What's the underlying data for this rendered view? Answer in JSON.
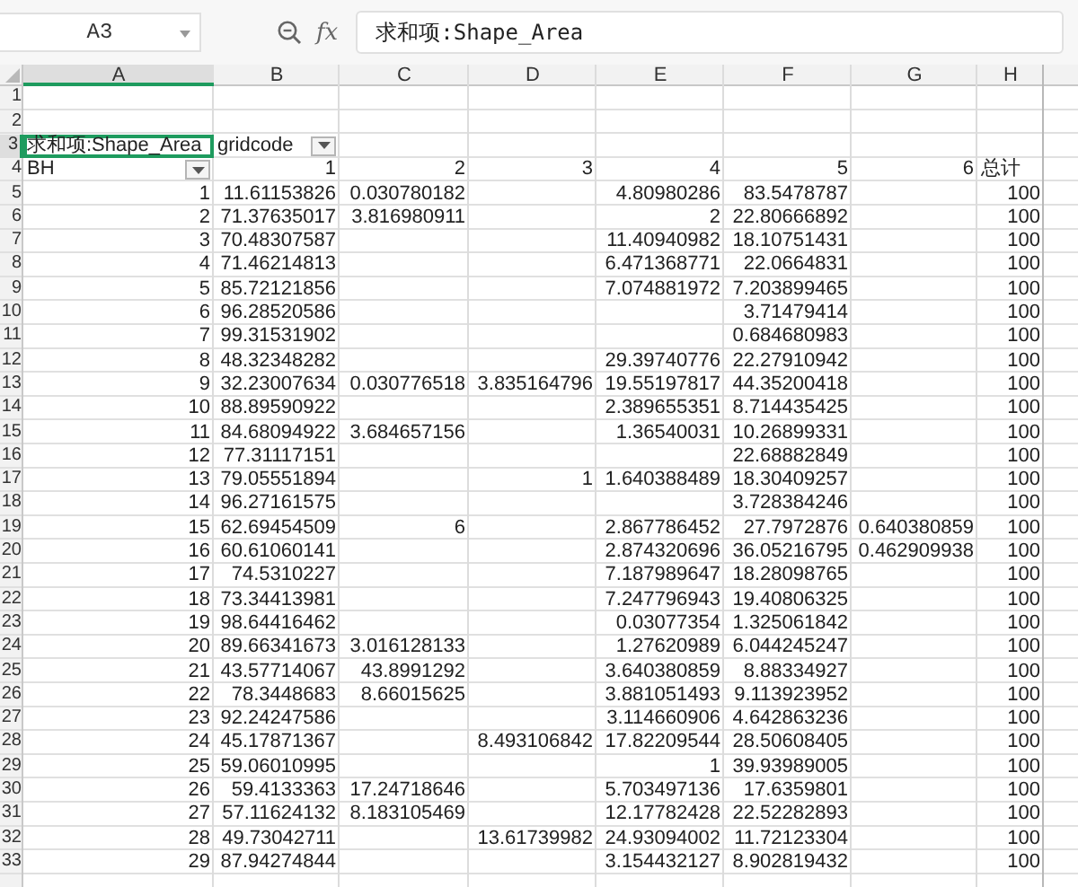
{
  "name_box": "A3",
  "fx_label": "fx",
  "formula": "求和项:Shape_Area",
  "columns": {
    "A": {
      "label": "A",
      "selected": true
    },
    "B": {
      "label": "B",
      "selected": false
    },
    "C": {
      "label": "C",
      "selected": false
    },
    "D": {
      "label": "D",
      "selected": false
    },
    "E": {
      "label": "E",
      "selected": false
    },
    "F": {
      "label": "F",
      "selected": false
    },
    "G": {
      "label": "G",
      "selected": false
    },
    "H": {
      "label": "H",
      "selected": false
    }
  },
  "rows": [
    {
      "row": "1",
      "selected": false
    },
    {
      "row": "2",
      "selected": false
    },
    {
      "row": "3",
      "selected": true,
      "cells": {
        "A": {
          "text": "求和项:Shape_Area",
          "kind": "label",
          "selected": true
        },
        "B": {
          "text": "gridcode",
          "kind": "label",
          "filter": true,
          "selected": false
        }
      }
    },
    {
      "row": "4",
      "selected": false,
      "cells": {
        "A": {
          "text": "BH",
          "kind": "label",
          "filter": true,
          "selected": false
        },
        "B": {
          "text": "1",
          "selected": false
        },
        "C": {
          "text": "2",
          "selected": false
        },
        "D": {
          "text": "3",
          "selected": false
        },
        "E": {
          "text": "4",
          "selected": false
        },
        "F": {
          "text": "5",
          "selected": false
        },
        "G": {
          "text": "6",
          "selected": false
        },
        "H": {
          "text": "总计",
          "kind": "label",
          "selected": false
        }
      }
    },
    {
      "row": "5",
      "selected": false,
      "cells": {
        "A": {
          "text": "1",
          "selected": false
        },
        "B": {
          "text": "11.61153826",
          "selected": false
        },
        "C": {
          "text": "0.030780182",
          "selected": false
        },
        "E": {
          "text": "4.80980286",
          "selected": false
        },
        "F": {
          "text": "83.5478787",
          "selected": false
        },
        "H": {
          "text": "100",
          "selected": false
        }
      }
    },
    {
      "row": "6",
      "selected": false,
      "cells": {
        "A": {
          "text": "2",
          "selected": false
        },
        "B": {
          "text": "71.37635017",
          "selected": false
        },
        "C": {
          "text": "3.816980911",
          "selected": false
        },
        "E": {
          "text": "2",
          "selected": false
        },
        "F": {
          "text": "22.80666892",
          "selected": false
        },
        "H": {
          "text": "100",
          "selected": false
        }
      }
    },
    {
      "row": "7",
      "selected": false,
      "cells": {
        "A": {
          "text": "3",
          "selected": false
        },
        "B": {
          "text": "70.48307587",
          "selected": false
        },
        "E": {
          "text": "11.40940982",
          "selected": false
        },
        "F": {
          "text": "18.10751431",
          "selected": false
        },
        "H": {
          "text": "100",
          "selected": false
        }
      }
    },
    {
      "row": "8",
      "selected": false,
      "cells": {
        "A": {
          "text": "4",
          "selected": false
        },
        "B": {
          "text": "71.46214813",
          "selected": false
        },
        "E": {
          "text": "6.471368771",
          "selected": false
        },
        "F": {
          "text": "22.0664831",
          "selected": false
        },
        "H": {
          "text": "100",
          "selected": false
        }
      }
    },
    {
      "row": "9",
      "selected": false,
      "cells": {
        "A": {
          "text": "5",
          "selected": false
        },
        "B": {
          "text": "85.72121856",
          "selected": false
        },
        "E": {
          "text": "7.074881972",
          "selected": false
        },
        "F": {
          "text": "7.203899465",
          "selected": false
        },
        "H": {
          "text": "100",
          "selected": false
        }
      }
    },
    {
      "row": "10",
      "selected": false,
      "cells": {
        "A": {
          "text": "6",
          "selected": false
        },
        "B": {
          "text": "96.28520586",
          "selected": false
        },
        "F": {
          "text": "3.71479414",
          "selected": false
        },
        "H": {
          "text": "100",
          "selected": false
        }
      }
    },
    {
      "row": "11",
      "selected": false,
      "cells": {
        "A": {
          "text": "7",
          "selected": false
        },
        "B": {
          "text": "99.31531902",
          "selected": false
        },
        "F": {
          "text": "0.684680983",
          "selected": false
        },
        "H": {
          "text": "100",
          "selected": false
        }
      }
    },
    {
      "row": "12",
      "selected": false,
      "cells": {
        "A": {
          "text": "8",
          "selected": false
        },
        "B": {
          "text": "48.32348282",
          "selected": false
        },
        "E": {
          "text": "29.39740776",
          "selected": false
        },
        "F": {
          "text": "22.27910942",
          "selected": false
        },
        "H": {
          "text": "100",
          "selected": false
        }
      }
    },
    {
      "row": "13",
      "selected": false,
      "cells": {
        "A": {
          "text": "9",
          "selected": false
        },
        "B": {
          "text": "32.23007634",
          "selected": false
        },
        "C": {
          "text": "0.030776518",
          "selected": false
        },
        "D": {
          "text": "3.835164796",
          "selected": false
        },
        "E": {
          "text": "19.55197817",
          "selected": false
        },
        "F": {
          "text": "44.35200418",
          "selected": false
        },
        "H": {
          "text": "100",
          "selected": false
        }
      }
    },
    {
      "row": "14",
      "selected": false,
      "cells": {
        "A": {
          "text": "10",
          "selected": false
        },
        "B": {
          "text": "88.89590922",
          "selected": false
        },
        "E": {
          "text": "2.389655351",
          "selected": false
        },
        "F": {
          "text": "8.714435425",
          "selected": false
        },
        "H": {
          "text": "100",
          "selected": false
        }
      }
    },
    {
      "row": "15",
      "selected": false,
      "cells": {
        "A": {
          "text": "11",
          "selected": false
        },
        "B": {
          "text": "84.68094922",
          "selected": false
        },
        "C": {
          "text": "3.684657156",
          "selected": false
        },
        "E": {
          "text": "1.36540031",
          "selected": false
        },
        "F": {
          "text": "10.26899331",
          "selected": false
        },
        "H": {
          "text": "100",
          "selected": false
        }
      }
    },
    {
      "row": "16",
      "selected": false,
      "cells": {
        "A": {
          "text": "12",
          "selected": false
        },
        "B": {
          "text": "77.31117151",
          "selected": false
        },
        "F": {
          "text": "22.68882849",
          "selected": false
        },
        "H": {
          "text": "100",
          "selected": false
        }
      }
    },
    {
      "row": "17",
      "selected": false,
      "cells": {
        "A": {
          "text": "13",
          "selected": false
        },
        "B": {
          "text": "79.05551894",
          "selected": false
        },
        "D": {
          "text": "1",
          "selected": false
        },
        "E": {
          "text": "1.640388489",
          "selected": false
        },
        "F": {
          "text": "18.30409257",
          "selected": false
        },
        "H": {
          "text": "100",
          "selected": false
        }
      }
    },
    {
      "row": "18",
      "selected": false,
      "cells": {
        "A": {
          "text": "14",
          "selected": false
        },
        "B": {
          "text": "96.27161575",
          "selected": false
        },
        "F": {
          "text": "3.728384246",
          "selected": false
        },
        "H": {
          "text": "100",
          "selected": false
        }
      }
    },
    {
      "row": "19",
      "selected": false,
      "cells": {
        "A": {
          "text": "15",
          "selected": false
        },
        "B": {
          "text": "62.69454509",
          "selected": false
        },
        "C": {
          "text": "6",
          "selected": false
        },
        "E": {
          "text": "2.867786452",
          "selected": false
        },
        "F": {
          "text": "27.7972876",
          "selected": false
        },
        "G": {
          "text": "0.640380859",
          "selected": false
        },
        "H": {
          "text": "100",
          "selected": false
        }
      }
    },
    {
      "row": "20",
      "selected": false,
      "cells": {
        "A": {
          "text": "16",
          "selected": false
        },
        "B": {
          "text": "60.61060141",
          "selected": false
        },
        "E": {
          "text": "2.874320696",
          "selected": false
        },
        "F": {
          "text": "36.05216795",
          "selected": false
        },
        "G": {
          "text": "0.462909938",
          "selected": false
        },
        "H": {
          "text": "100",
          "selected": false
        }
      }
    },
    {
      "row": "21",
      "selected": false,
      "cells": {
        "A": {
          "text": "17",
          "selected": false
        },
        "B": {
          "text": "74.5310227",
          "selected": false
        },
        "E": {
          "text": "7.187989647",
          "selected": false
        },
        "F": {
          "text": "18.28098765",
          "selected": false
        },
        "H": {
          "text": "100",
          "selected": false
        }
      }
    },
    {
      "row": "22",
      "selected": false,
      "cells": {
        "A": {
          "text": "18",
          "selected": false
        },
        "B": {
          "text": "73.34413981",
          "selected": false
        },
        "E": {
          "text": "7.247796943",
          "selected": false
        },
        "F": {
          "text": "19.40806325",
          "selected": false
        },
        "H": {
          "text": "100",
          "selected": false
        }
      }
    },
    {
      "row": "23",
      "selected": false,
      "cells": {
        "A": {
          "text": "19",
          "selected": false
        },
        "B": {
          "text": "98.64416462",
          "selected": false
        },
        "E": {
          "text": "0.03077354",
          "selected": false
        },
        "F": {
          "text": "1.325061842",
          "selected": false
        },
        "H": {
          "text": "100",
          "selected": false
        }
      }
    },
    {
      "row": "24",
      "selected": false,
      "cells": {
        "A": {
          "text": "20",
          "selected": false
        },
        "B": {
          "text": "89.66341673",
          "selected": false
        },
        "C": {
          "text": "3.016128133",
          "selected": false
        },
        "E": {
          "text": "1.27620989",
          "selected": false
        },
        "F": {
          "text": "6.044245247",
          "selected": false
        },
        "H": {
          "text": "100",
          "selected": false
        }
      }
    },
    {
      "row": "25",
      "selected": false,
      "cells": {
        "A": {
          "text": "21",
          "selected": false
        },
        "B": {
          "text": "43.57714067",
          "selected": false
        },
        "C": {
          "text": "43.8991292",
          "selected": false
        },
        "E": {
          "text": "3.640380859",
          "selected": false
        },
        "F": {
          "text": "8.88334927",
          "selected": false
        },
        "H": {
          "text": "100",
          "selected": false
        }
      }
    },
    {
      "row": "26",
      "selected": false,
      "cells": {
        "A": {
          "text": "22",
          "selected": false
        },
        "B": {
          "text": "78.3448683",
          "selected": false
        },
        "C": {
          "text": "8.66015625",
          "selected": false
        },
        "E": {
          "text": "3.881051493",
          "selected": false
        },
        "F": {
          "text": "9.113923952",
          "selected": false
        },
        "H": {
          "text": "100",
          "selected": false
        }
      }
    },
    {
      "row": "27",
      "selected": false,
      "cells": {
        "A": {
          "text": "23",
          "selected": false
        },
        "B": {
          "text": "92.24247586",
          "selected": false
        },
        "E": {
          "text": "3.114660906",
          "selected": false
        },
        "F": {
          "text": "4.642863236",
          "selected": false
        },
        "H": {
          "text": "100",
          "selected": false
        }
      }
    },
    {
      "row": "28",
      "selected": false,
      "cells": {
        "A": {
          "text": "24",
          "selected": false
        },
        "B": {
          "text": "45.17871367",
          "selected": false
        },
        "D": {
          "text": "8.493106842",
          "selected": false
        },
        "E": {
          "text": "17.82209544",
          "selected": false
        },
        "F": {
          "text": "28.50608405",
          "selected": false
        },
        "H": {
          "text": "100",
          "selected": false
        }
      }
    },
    {
      "row": "29",
      "selected": false,
      "cells": {
        "A": {
          "text": "25",
          "selected": false
        },
        "B": {
          "text": "59.06010995",
          "selected": false
        },
        "E": {
          "text": "1",
          "selected": false
        },
        "F": {
          "text": "39.93989005",
          "selected": false
        },
        "H": {
          "text": "100",
          "selected": false
        }
      }
    },
    {
      "row": "30",
      "selected": false,
      "cells": {
        "A": {
          "text": "26",
          "selected": false
        },
        "B": {
          "text": "59.4133363",
          "selected": false
        },
        "C": {
          "text": "17.24718646",
          "selected": false
        },
        "E": {
          "text": "5.703497136",
          "selected": false
        },
        "F": {
          "text": "17.6359801",
          "selected": false
        },
        "H": {
          "text": "100",
          "selected": false
        }
      }
    },
    {
      "row": "31",
      "selected": false,
      "cells": {
        "A": {
          "text": "27",
          "selected": false
        },
        "B": {
          "text": "57.11624132",
          "selected": false
        },
        "C": {
          "text": "8.183105469",
          "selected": false
        },
        "E": {
          "text": "12.17782428",
          "selected": false
        },
        "F": {
          "text": "22.52282893",
          "selected": false
        },
        "H": {
          "text": "100",
          "selected": false
        }
      }
    },
    {
      "row": "32",
      "selected": false,
      "cells": {
        "A": {
          "text": "28",
          "selected": false
        },
        "B": {
          "text": "49.73042711",
          "selected": false
        },
        "D": {
          "text": "13.61739982",
          "selected": false
        },
        "E": {
          "text": "24.93094002",
          "selected": false
        },
        "F": {
          "text": "11.72123304",
          "selected": false
        },
        "H": {
          "text": "100",
          "selected": false
        }
      }
    },
    {
      "row": "33",
      "selected": false,
      "cells": {
        "A": {
          "text": "29",
          "selected": false
        },
        "B": {
          "text": "87.94274844",
          "selected": false
        },
        "E": {
          "text": "3.154432127",
          "selected": false
        },
        "F": {
          "text": "8.902819432",
          "selected": false
        },
        "H": {
          "text": "100",
          "selected": false
        }
      }
    }
  ]
}
